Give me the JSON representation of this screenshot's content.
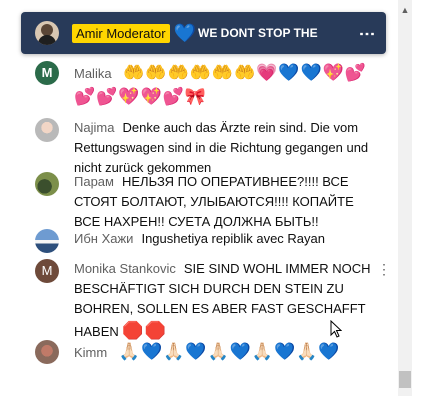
{
  "pinned": {
    "badge": "Amir Moderator",
    "emoji": "💙",
    "message": "WE DONT STOP THE ..."
  },
  "messages": [
    {
      "author": "Malika",
      "avatar_letter": "M",
      "text": "",
      "emoji": "🤲🤲🤲🤲🤲🤲💗💙💙💖💕💕💕💖💖💕🎀"
    },
    {
      "author": "Najima",
      "text": "Denke auch das Ärzte rein sind. Die vom Rettungswagen sind in die Richtung gegangen und nicht zurück gekommen",
      "emoji": ""
    },
    {
      "author": "Парам",
      "text": "НЕЛЬЗЯ ПО ОПЕРАТИВНЕЕ?!!!! ВСЕ СТОЯТ БОЛТАЮТ, УЛЫБАЮТСЯ!!!! КОПАЙТЕ ВСЕ НАХРЕН!! СУЕТА ДОЛЖНА БЫТЬ!!",
      "emoji": ""
    },
    {
      "author": "Ибн Хажи",
      "text": "Ingushetiya repiblik avec Rayan",
      "emoji": ""
    },
    {
      "author": "Monika Stankovic",
      "avatar_letter": "M",
      "text": "SIE SIND WOHL IMMER NOCH BESCHÄFTIGT SICH DURCH DEN STEIN ZU BOHREN, SOLLEN ES ABER FAST GESCHAFFT HABEN",
      "emoji": "🛑🛑"
    },
    {
      "author": "Kimm",
      "text": "",
      "emoji": "🙏🏻💙🙏🏻💙🙏🏻💙🙏🏻💙🙏🏻💙"
    }
  ],
  "icons": {
    "pinned_menu": "kebab-icon",
    "message_menu": "kebab-icon",
    "scroll_up": "chevron-up-icon",
    "cursor": "mouse-pointer-icon"
  }
}
